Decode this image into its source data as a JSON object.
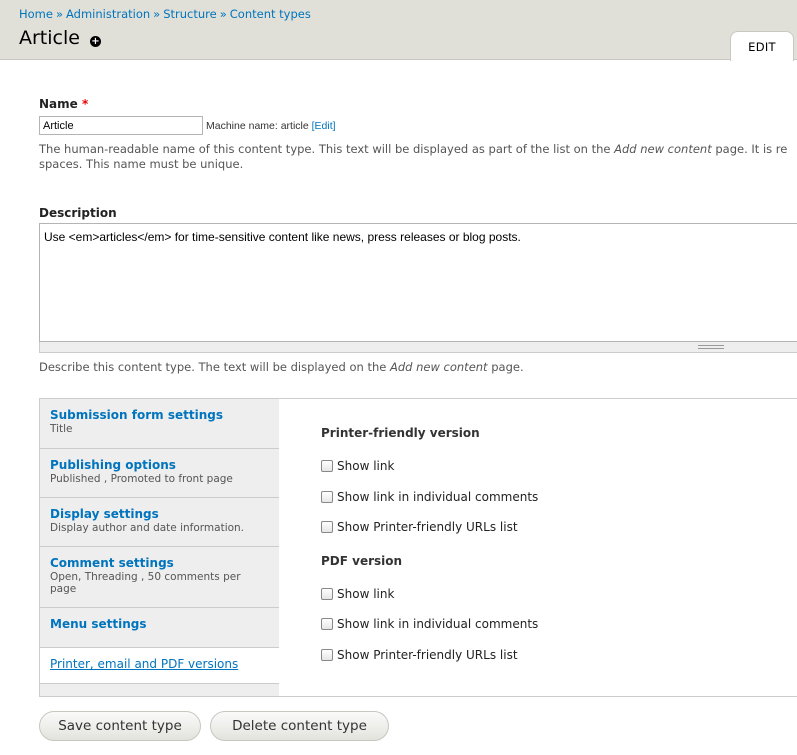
{
  "breadcrumb": [
    "Home",
    "Administration",
    "Structure",
    "Content types"
  ],
  "breadcrumb_sep": "»",
  "page_title": "Article",
  "shortcut_icon": "add-shortcut-icon",
  "tabs": {
    "edit": "EDIT"
  },
  "name_field": {
    "label": "Name",
    "required_marker": "*",
    "value": "Article",
    "machine_name_prefix": "Machine name: article",
    "edit_link": "[Edit]",
    "help_line1_pre": "The human-readable name of this content type. This text will be displayed as part of the list on the ",
    "help_line1_em": "Add new content",
    "help_line1_post": " page. It is re",
    "help_line2": "spaces. This name must be unique."
  },
  "description_field": {
    "label": "Description",
    "value": "Use <em>articles</em> for time-sensitive content like news, press releases or blog posts.",
    "help_pre": "Describe this content type. The text will be displayed on the ",
    "help_em": "Add new content",
    "help_post": " page."
  },
  "vertical_tabs": [
    {
      "title": "Submission form settings",
      "summary": "Title"
    },
    {
      "title": "Publishing options",
      "summary": "Published , Promoted to front page"
    },
    {
      "title": "Display settings",
      "summary": "Display author and date information."
    },
    {
      "title": "Comment settings",
      "summary": "Open, Threading , 50 comments per page"
    },
    {
      "title": "Menu settings",
      "summary": ""
    },
    {
      "title": "Printer, email and PDF versions",
      "summary": "",
      "selected": true
    }
  ],
  "pane": {
    "printer_section": "Printer-friendly version",
    "printer_options": [
      "Show link",
      "Show link in individual comments",
      "Show Printer-friendly URLs list"
    ],
    "pdf_section": "PDF version",
    "pdf_options": [
      "Show link",
      "Show link in individual comments",
      "Show Printer-friendly URLs list"
    ]
  },
  "buttons": {
    "save": "Save content type",
    "delete": "Delete content type"
  },
  "colors": {
    "link": "#0074bd",
    "header_bg": "#e0e0d8",
    "required": "#ee0000"
  }
}
